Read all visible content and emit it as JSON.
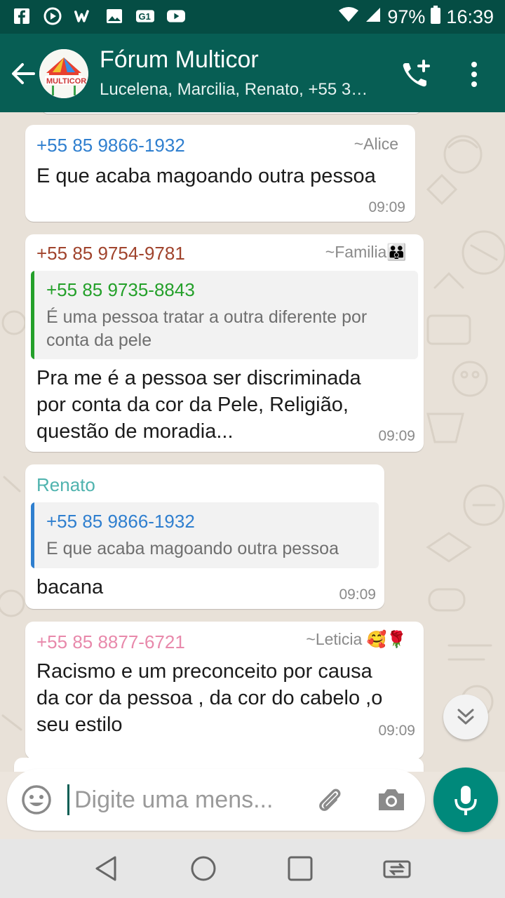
{
  "status_bar": {
    "battery": "97%",
    "time": "16:39",
    "icons_left": [
      "facebook-icon",
      "play-icon",
      "wattpad-icon",
      "gallery-icon",
      "g1-icon",
      "youtube-icon"
    ]
  },
  "header": {
    "title": "Fórum Multicor",
    "subtitle": "Lucelena, Marcilia, Renato, +55 3…",
    "avatar_text": "MULTICOR"
  },
  "messages": [
    {
      "sender": "+55 85 9866-1932",
      "sender_color": "#2f7fcf",
      "alias": "~Alice",
      "text_lines": [
        "E que acaba magoando outra pessoa"
      ],
      "time": "09:09"
    },
    {
      "sender": "+55 85 9754-9781",
      "sender_color": "#a0432c",
      "alias": "~Familia👪",
      "quote": {
        "sender": "+55 85 9735-8843",
        "color": "#24a02a",
        "lines": [
          "É uma pessoa tratar a outra diferente por",
          "conta da pele"
        ]
      },
      "text_lines": [
        "Pra me é a pessoa ser discriminada",
        "por conta da cor da  Pele, Religião,",
        "questão de moradia..."
      ],
      "time": "09:09"
    },
    {
      "sender": "Renato",
      "sender_color": "#4fb3ae",
      "quote": {
        "sender": "+55 85 9866-1932",
        "color": "#2f7fcf",
        "lines": [
          "E que acaba magoando outra pessoa"
        ]
      },
      "text_lines": [
        "bacana"
      ],
      "time": "09:09"
    },
    {
      "sender": "+55 85 8877-6721",
      "sender_color": "#e889ab",
      "alias": "~Leticia 🥰🌹",
      "text_lines": [
        "Racismo e um preconceito por causa",
        "da cor da pessoa , da cor do cabelo ,o",
        "seu estilo"
      ],
      "time": "09:09"
    }
  ],
  "composer": {
    "placeholder": "Digite uma mens..."
  },
  "colors": {
    "header": "#075e54",
    "status_bar": "#054d44",
    "accent": "#00897b"
  }
}
